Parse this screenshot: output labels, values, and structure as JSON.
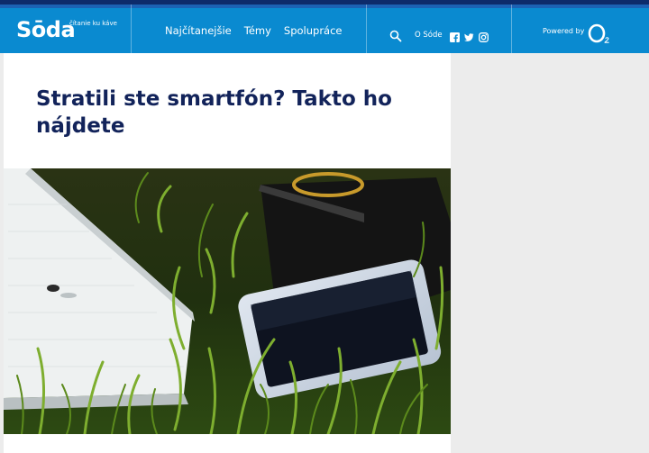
{
  "header": {
    "logo": "Sōda",
    "tagline": "čítanie ku káve",
    "nav": [
      "Najčítanejšie",
      "Témy",
      "Spolupráce"
    ],
    "about": "O Sóde",
    "powered_by": "Powered by",
    "icons": [
      "search-icon",
      "facebook-icon",
      "twitter-icon",
      "instagram-icon",
      "o2-logo"
    ]
  },
  "article": {
    "title": "Stratili ste smartfón? Takto ho nájdete"
  },
  "colors": {
    "header_bg": "#0a8ad0",
    "header_top": "#0d2b6b",
    "title": "#12235a",
    "sidebar_bg": "#ececec"
  }
}
